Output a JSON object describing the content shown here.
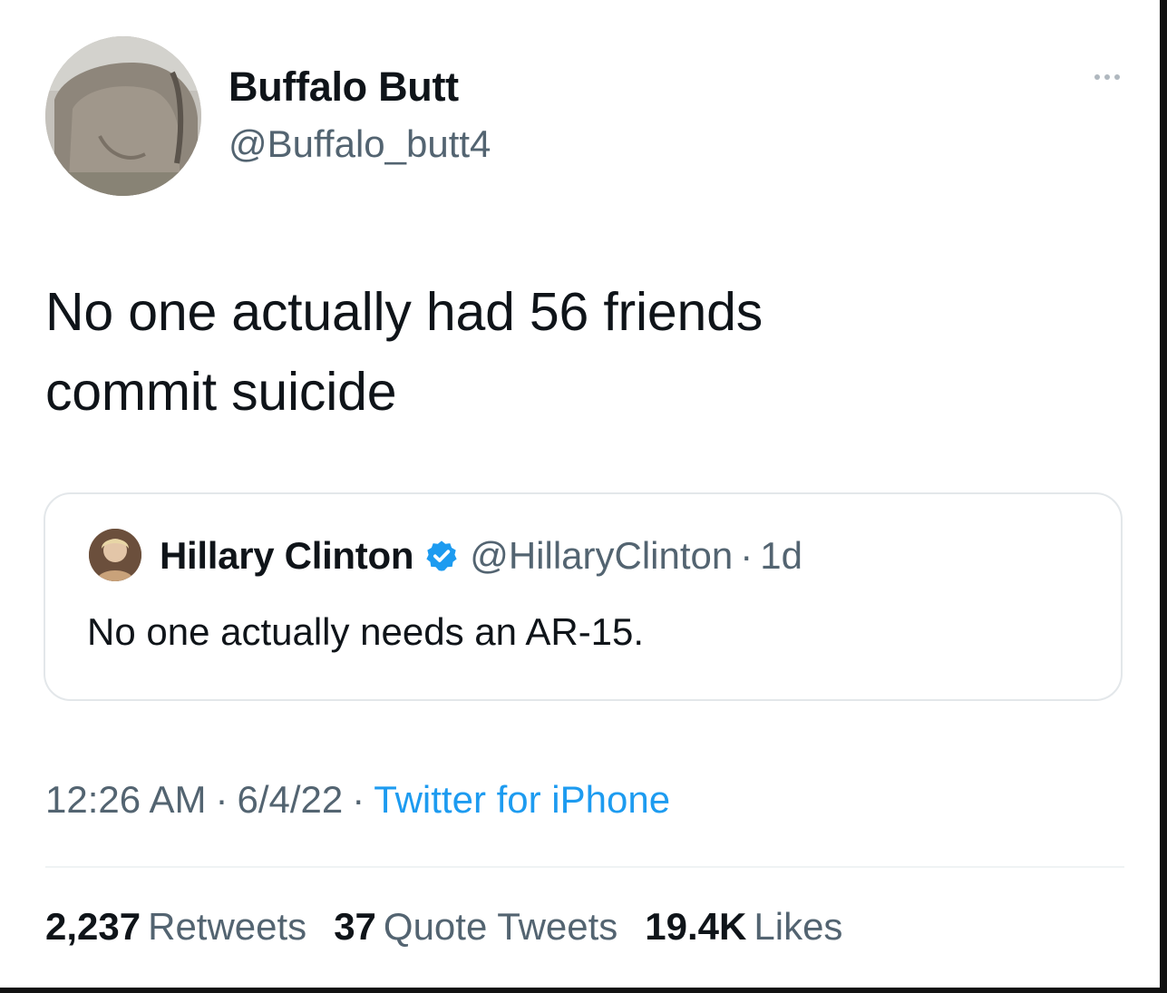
{
  "tweet": {
    "author": {
      "display_name": "Buffalo Butt",
      "handle": "@Buffalo_butt4",
      "avatar_icon": "buffalo-avatar"
    },
    "more_icon": "more-dots-icon",
    "text_line1": "No one actually had 56 friends",
    "text_line2": "commit suicide",
    "quote": {
      "author_name": "Hillary Clinton",
      "verified_icon": "verified-badge-icon",
      "handle": "@HillaryClinton",
      "separator": "·",
      "time": "1d",
      "text": "No one actually needs an AR-15."
    },
    "meta": {
      "time": "12:26 AM",
      "dot": "·",
      "date": "6/4/22",
      "source": "Twitter for iPhone"
    },
    "stats": {
      "retweets_count": "2,237",
      "retweets_label": "Retweets",
      "quotes_count": "37",
      "quotes_label": "Quote Tweets",
      "likes_count": "19.4K",
      "likes_label": "Likes"
    },
    "colors": {
      "link": "#1d9bf0",
      "secondary_text": "#536471",
      "primary_text": "#0f1419",
      "verified": "#1d9bf0"
    }
  }
}
